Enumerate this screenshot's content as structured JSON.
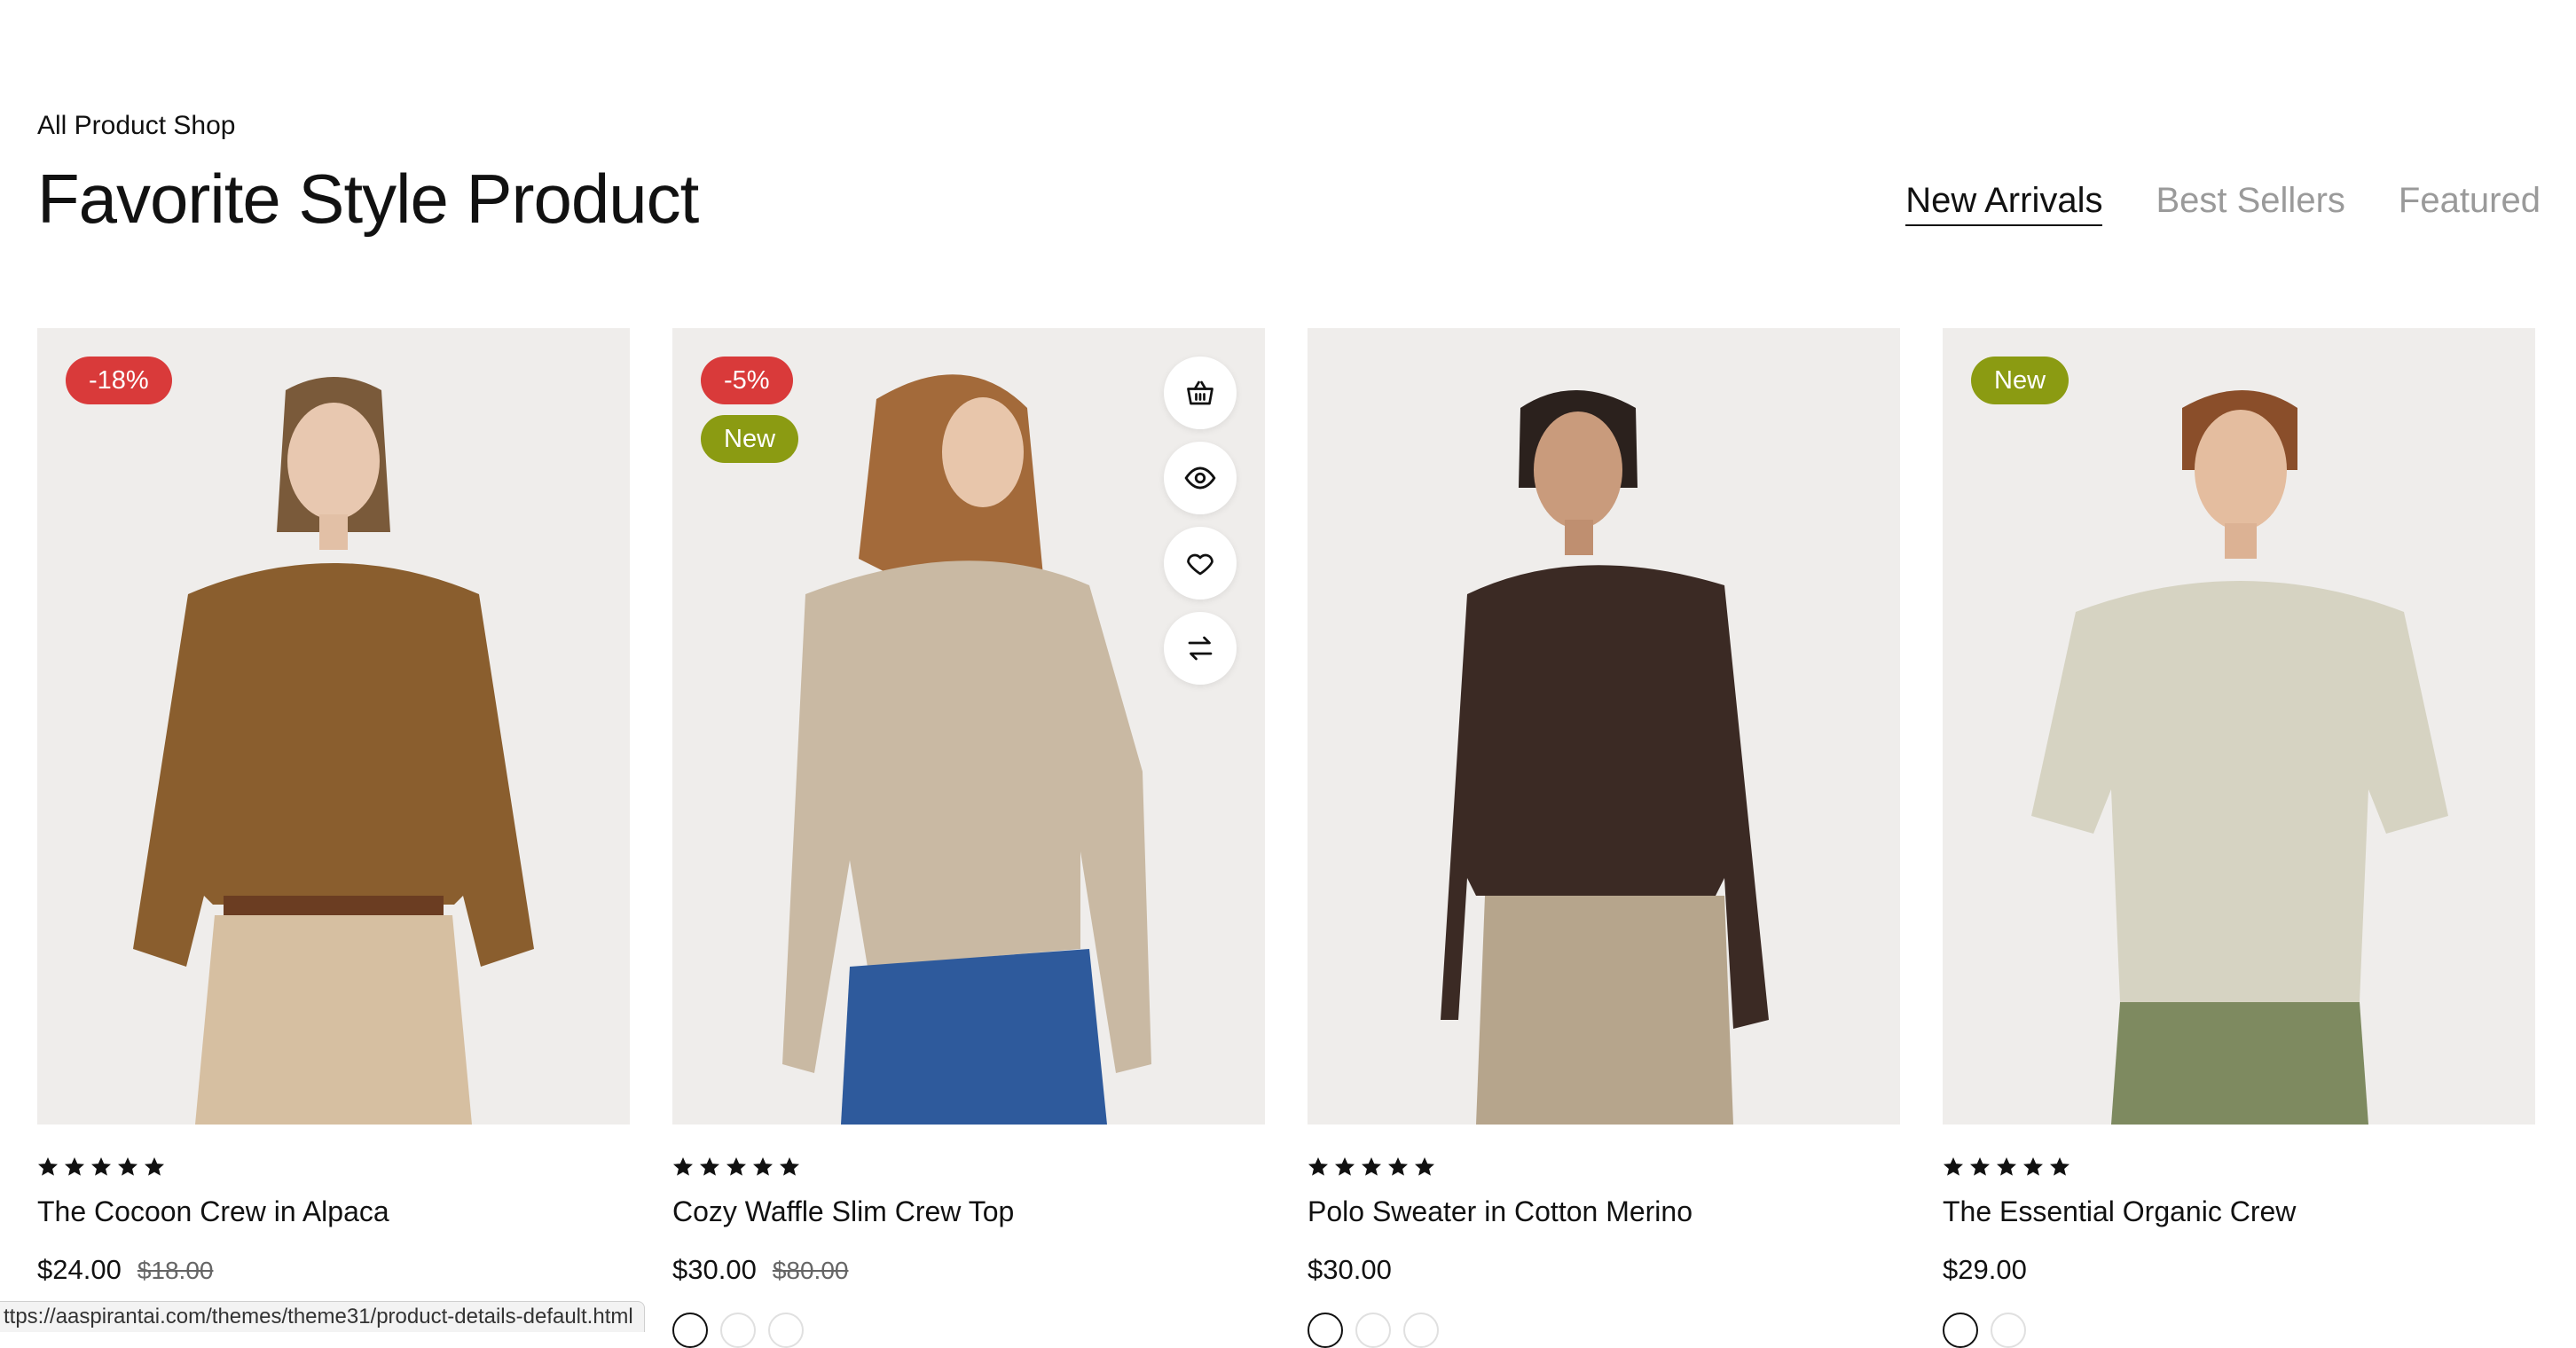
{
  "header": {
    "eyebrow": "All Product Shop",
    "title": "Favorite Style Product"
  },
  "tabs": [
    {
      "label": "New Arrivals",
      "active": true
    },
    {
      "label": "Best Sellers",
      "active": false
    },
    {
      "label": "Featured",
      "active": false
    }
  ],
  "products": [
    {
      "name": "The Cocoon Crew in Alpaca",
      "price": "$24.00",
      "old_price": "$18.00",
      "badges": [
        "-18%"
      ],
      "rating": 5,
      "garment_color": "#8a5e2e"
    },
    {
      "name": "Cozy Waffle Slim Crew Top",
      "price": "$30.00",
      "old_price": "$80.00",
      "badges": [
        "-5%",
        "New"
      ],
      "rating": 5,
      "garment_color": "#c9b9a3",
      "actions": [
        "basket-icon",
        "eye-icon",
        "heart-icon",
        "compare-icon"
      ]
    },
    {
      "name": "Polo Sweater in Cotton Merino",
      "price": "$30.00",
      "old_price": "",
      "badges": [],
      "rating": 5,
      "garment_color": "#3b2a24"
    },
    {
      "name": "The Essential Organic Crew",
      "price": "$29.00",
      "old_price": "",
      "badges": [
        "New"
      ],
      "rating": 5,
      "garment_color": "#d6d3c2"
    }
  ],
  "colors": {
    "sale_badge": "#d93a3a",
    "new_badge": "#8b9b12",
    "image_bg": "#efedeb"
  },
  "status_bar": {
    "url": "ttps://aaspirantai.com/themes/theme31/product-details-default.html"
  }
}
